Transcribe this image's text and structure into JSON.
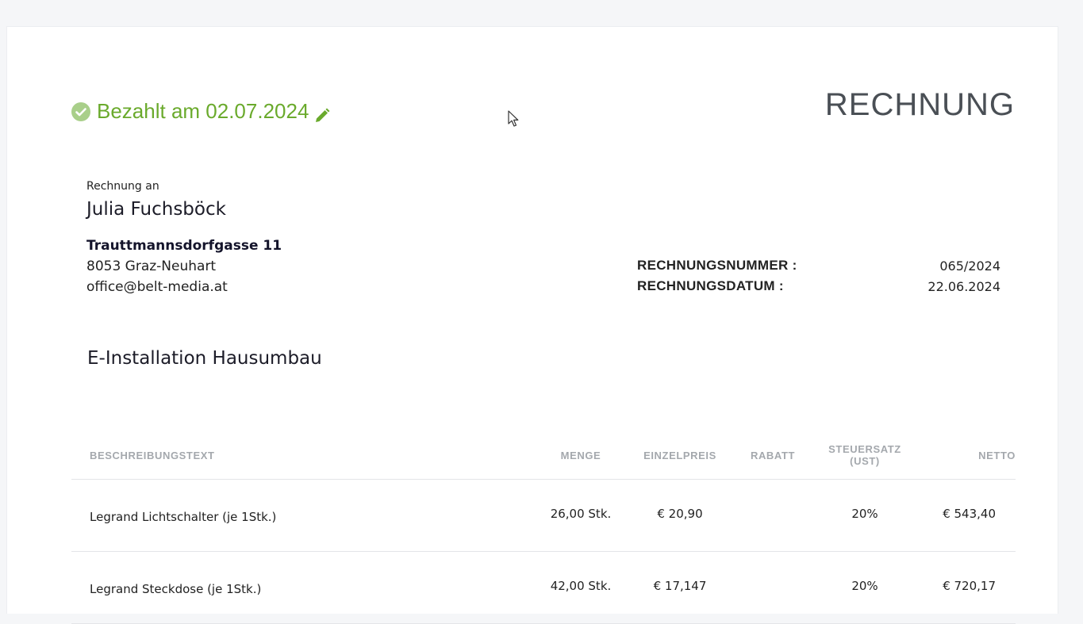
{
  "status": {
    "paid_text": "Bezahlt am 02.07.2024",
    "color": "#6aaa2c"
  },
  "document": {
    "title": "RECHNUNG"
  },
  "recipient": {
    "label": "Rechnung an",
    "name": "Julia Fuchsböck",
    "street": "Trauttmannsdorfgasse 11",
    "city": "8053 Graz-Neuhart",
    "email": "office@belt-media.at"
  },
  "meta": {
    "number_label": "RECHNUNGSNUMMER :",
    "number_value": "065/2024",
    "date_label": "RECHNUNGSDATUM :",
    "date_value": "22.06.2024"
  },
  "project": {
    "title": "E-Installation Hausumbau"
  },
  "table": {
    "headers": {
      "description": "BESCHREIBUNGSTEXT",
      "quantity": "MENGE",
      "unit_price": "EINZELPREIS",
      "discount": "RABATT",
      "tax_rate_line1": "STEUERSATZ",
      "tax_rate_line2": "(UST)",
      "net": "NETTO"
    },
    "rows": [
      {
        "description": "Legrand Lichtschalter (je 1Stk.)",
        "quantity": "26,00 Stk.",
        "unit_price": "€ 20,90",
        "discount": "",
        "tax_rate": "20%",
        "net": "€ 543,40"
      },
      {
        "description": "Legrand Steckdose (je 1Stk.)",
        "quantity": "42,00 Stk.",
        "unit_price": "€ 17,147",
        "discount": "",
        "tax_rate": "20%",
        "net": "€ 720,17"
      }
    ]
  }
}
